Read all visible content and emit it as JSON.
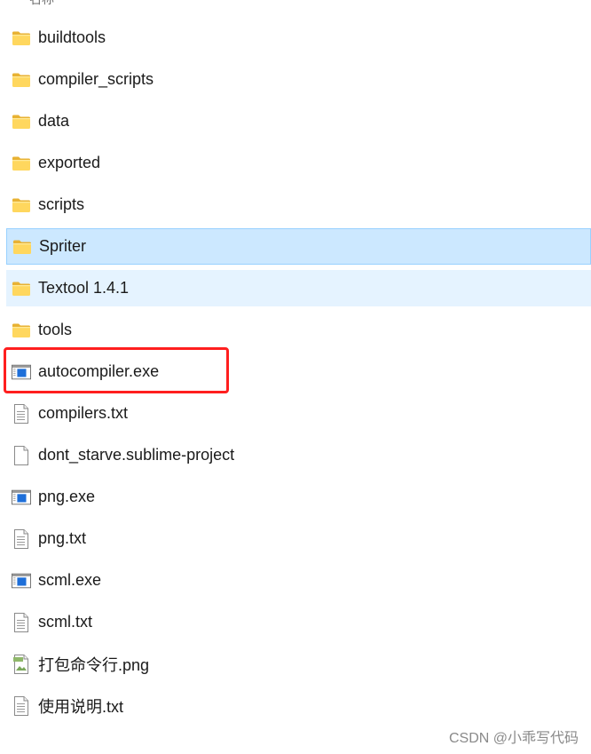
{
  "header": {
    "column_label": "名称"
  },
  "items": [
    {
      "name": "buildtools",
      "icon": "folder-icon",
      "type": "folder",
      "state": "normal"
    },
    {
      "name": "compiler_scripts",
      "icon": "folder-icon",
      "type": "folder",
      "state": "normal"
    },
    {
      "name": "data",
      "icon": "folder-icon",
      "type": "folder",
      "state": "normal"
    },
    {
      "name": "exported",
      "icon": "folder-icon",
      "type": "folder",
      "state": "normal"
    },
    {
      "name": "scripts",
      "icon": "folder-icon",
      "type": "folder",
      "state": "normal"
    },
    {
      "name": "Spriter",
      "icon": "folder-icon",
      "type": "folder",
      "state": "selected"
    },
    {
      "name": "Textool 1.4.1",
      "icon": "folder-icon",
      "type": "folder",
      "state": "hover"
    },
    {
      "name": "tools",
      "icon": "folder-icon",
      "type": "folder",
      "state": "normal"
    },
    {
      "name": "autocompiler.exe",
      "icon": "exe-icon",
      "type": "exe",
      "state": "highlighted"
    },
    {
      "name": "compilers.txt",
      "icon": "text-file-icon",
      "type": "txt",
      "state": "normal"
    },
    {
      "name": "dont_starve.sublime-project",
      "icon": "blank-file-icon",
      "type": "file",
      "state": "normal"
    },
    {
      "name": "png.exe",
      "icon": "exe-icon",
      "type": "exe",
      "state": "normal"
    },
    {
      "name": "png.txt",
      "icon": "text-file-icon",
      "type": "txt",
      "state": "normal"
    },
    {
      "name": "scml.exe",
      "icon": "exe-icon",
      "type": "exe",
      "state": "normal"
    },
    {
      "name": "scml.txt",
      "icon": "text-file-icon",
      "type": "txt",
      "state": "normal"
    },
    {
      "name": "打包命令行.png",
      "icon": "image-file-icon",
      "type": "png",
      "state": "normal"
    },
    {
      "name": "使用说明.txt",
      "icon": "text-file-icon",
      "type": "txt",
      "state": "normal"
    }
  ],
  "annotation": {
    "highlight_color": "#ff1f1f"
  },
  "colors": {
    "selected_bg": "#cce8ff",
    "selected_border": "#99d1ff",
    "hover_bg": "#e5f3ff",
    "folder_yellow": "#ffd75e",
    "exe_blue": "#1e6fd9"
  },
  "watermark": {
    "text": "CSDN @小乖写代码"
  }
}
